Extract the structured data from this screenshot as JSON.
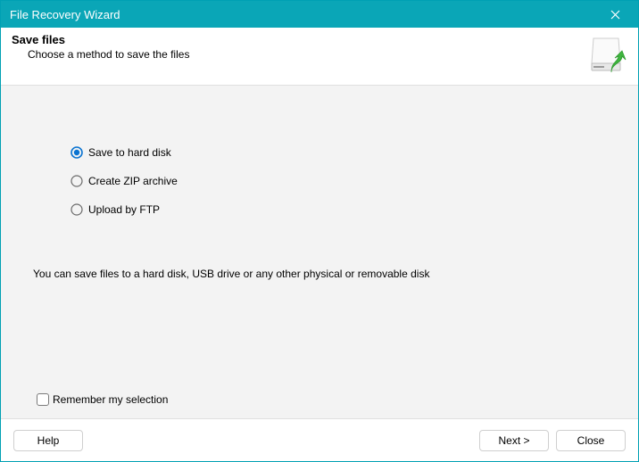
{
  "window": {
    "title": "File Recovery Wizard"
  },
  "header": {
    "title": "Save files",
    "subtitle": "Choose a method to save the files"
  },
  "options": [
    {
      "label": "Save to hard disk",
      "selected": true
    },
    {
      "label": "Create ZIP archive",
      "selected": false
    },
    {
      "label": "Upload by FTP",
      "selected": false
    }
  ],
  "description": "You can save files to a hard disk, USB drive or any other physical or removable disk",
  "remember": {
    "label": "Remember my selection",
    "checked": false
  },
  "footer": {
    "help": "Help",
    "next": "Next >",
    "close": "Close"
  },
  "icons": {
    "close": "close-icon",
    "header": "hdd-restore-icon"
  },
  "colors": {
    "accent": "#0aa6b7",
    "radio_selected": "#0b74d1"
  }
}
